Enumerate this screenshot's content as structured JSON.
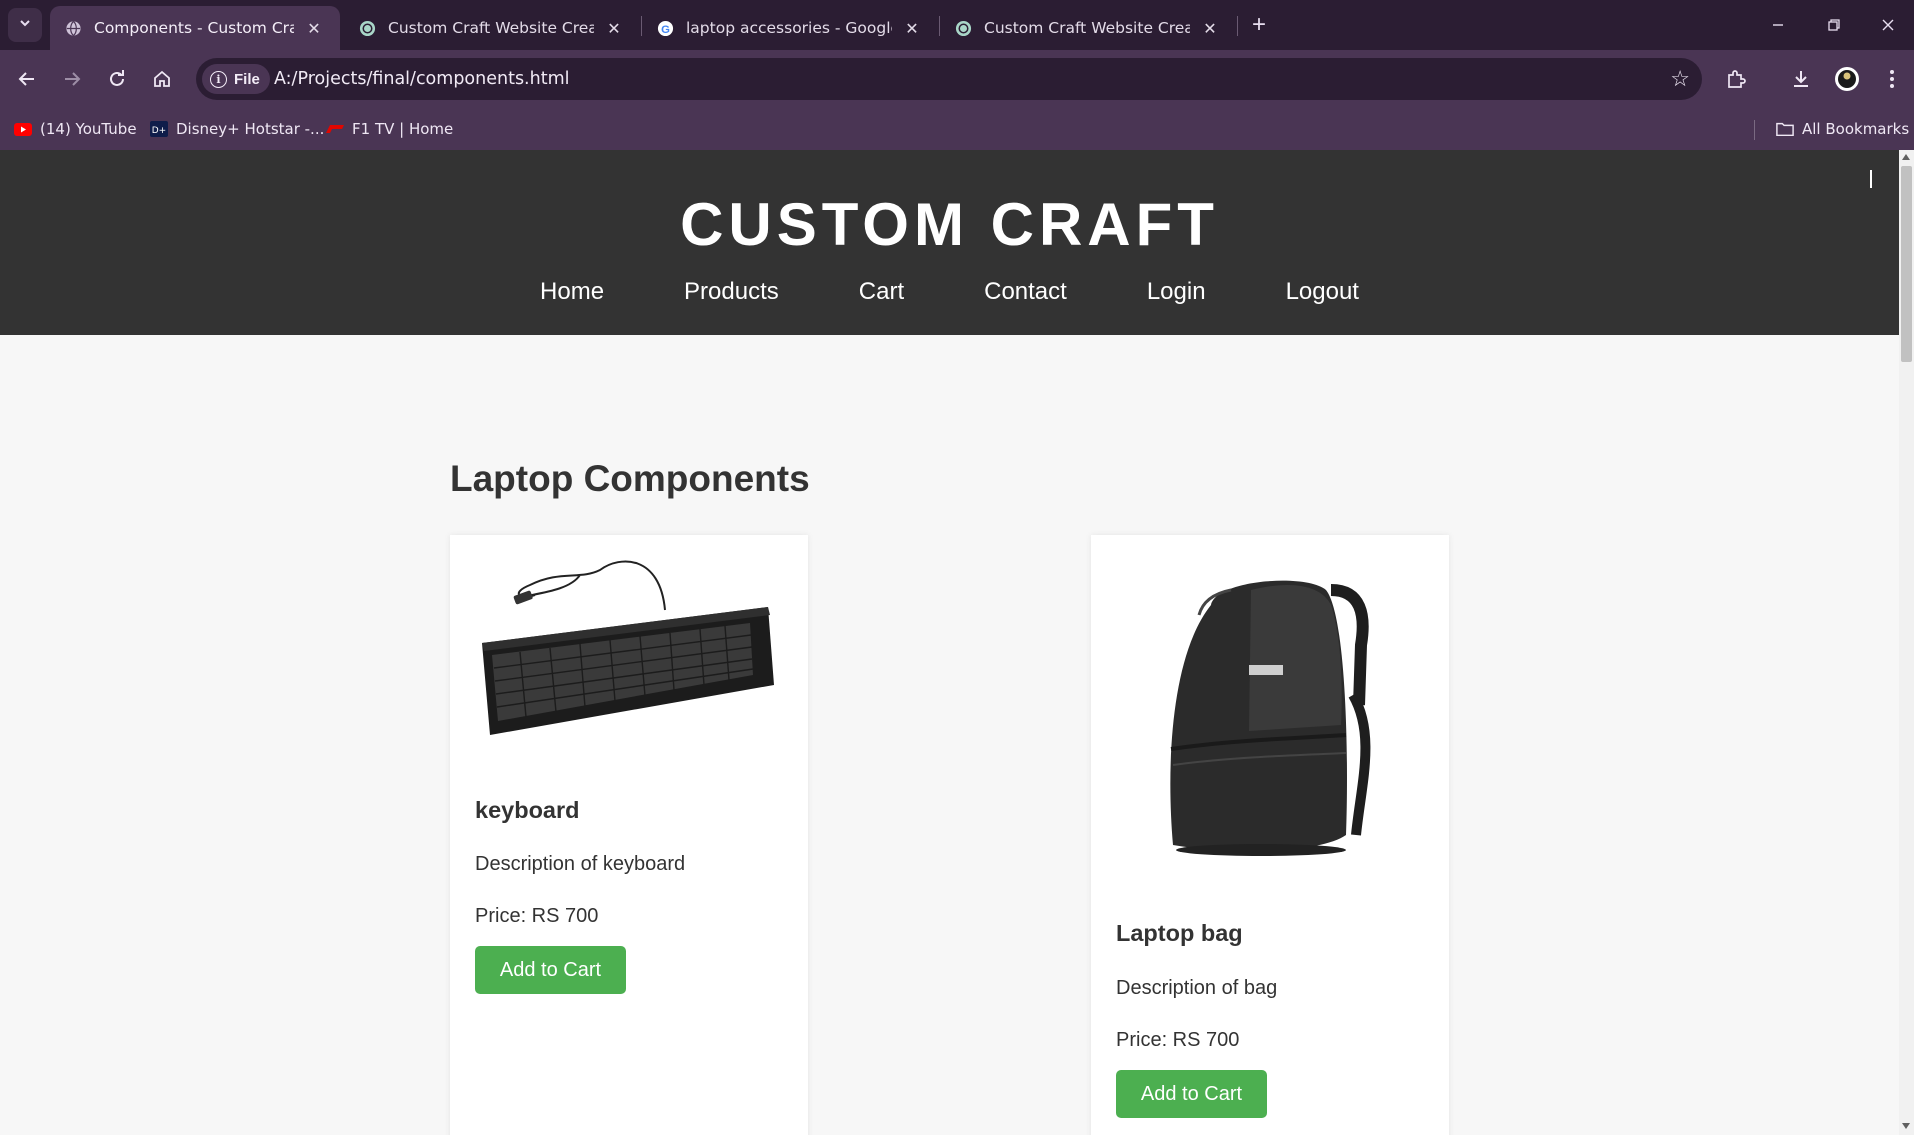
{
  "browser": {
    "tabs": [
      {
        "title": "Components - Custom Craft",
        "active": true,
        "favicon": "globe-icon"
      },
      {
        "title": "Custom Craft Website Creation",
        "active": false,
        "favicon": "chatgpt-icon"
      },
      {
        "title": "laptop accessories - Google Sea",
        "active": false,
        "favicon": "google-icon"
      },
      {
        "title": "Custom Craft Website Creation",
        "active": false,
        "favicon": "chatgpt-icon"
      }
    ],
    "site_chip": "File",
    "url": "A:/Projects/final/components.html",
    "bookmarks": [
      {
        "label": "(14) YouTube",
        "icon": "youtube-icon"
      },
      {
        "label": "Disney+ Hotstar -...",
        "icon": "hotstar-icon"
      },
      {
        "label": "F1 TV | Home",
        "icon": "f1-icon"
      }
    ],
    "all_bookmarks": "All Bookmarks"
  },
  "site": {
    "brand": "CUSTOM CRAFT",
    "nav": [
      "Home",
      "Products",
      "Cart",
      "Contact",
      "Login",
      "Logout"
    ]
  },
  "main": {
    "section_title": "Laptop Components",
    "products": [
      {
        "name": "keyboard",
        "description": "Description of keyboard",
        "price": "Price: RS 700",
        "button": "Add to Cart",
        "image": "keyboard-image"
      },
      {
        "name": "Laptop bag",
        "description": "Description of bag",
        "price": "Price: RS 700",
        "button": "Add to Cart",
        "image": "backpack-image"
      }
    ]
  },
  "colors": {
    "header_bg": "#333333",
    "button_green": "#4caf50",
    "browser_frame": "#2b1d33",
    "browser_toolbar": "#4a3554"
  }
}
